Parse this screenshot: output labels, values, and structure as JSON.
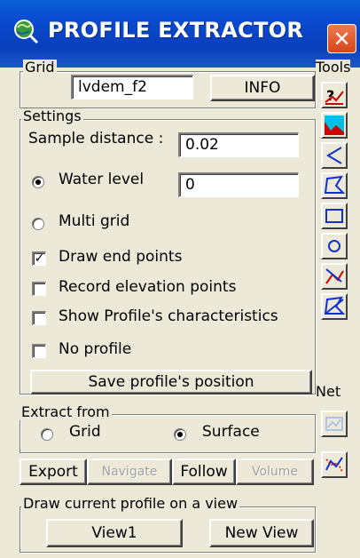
{
  "window": {
    "title": "PROFILE EXTRACTOR"
  },
  "grid": {
    "legend": "Grid",
    "value": "lvdem_f2",
    "info_label": "INFO"
  },
  "tools": {
    "legend": "Tools"
  },
  "settings": {
    "legend": "Settings",
    "sample_distance_label": "Sample distance :",
    "sample_distance_value": "0.02",
    "water_level_label": "Water level",
    "water_level_value": "0",
    "multi_grid_label": "Multi grid",
    "mode_selected": "Water level",
    "draw_end_points_label": "Draw end points",
    "draw_end_points_checked": true,
    "record_elevation_label": "Record elevation points",
    "record_elevation_checked": false,
    "show_characteristics_label": "Show Profile's characteristics",
    "show_characteristics_checked": false,
    "no_profile_label": "No profile",
    "no_profile_checked": false,
    "save_position_label": "Save profile's position"
  },
  "extract": {
    "legend": "Extract from",
    "grid_label": "Grid",
    "surface_label": "Surface",
    "selected": "Surface"
  },
  "actions": {
    "export_label": "Export",
    "navigate_label": "Navigate",
    "follow_label": "Follow",
    "volume_label": "Volume"
  },
  "net": {
    "legend": "Net"
  },
  "draw_view": {
    "legend": "Draw current profile on a view",
    "view1_label": "View1",
    "new_view_label": "New View"
  }
}
